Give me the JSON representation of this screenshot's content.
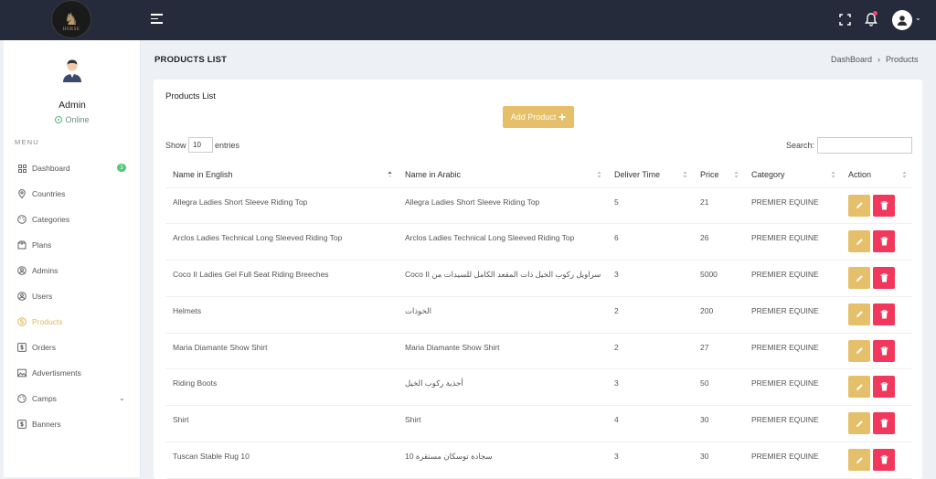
{
  "header": {
    "logo_text": "HORSE"
  },
  "sidebar": {
    "profile_name": "Admin",
    "profile_status": "Online",
    "menu_heading": "MENU",
    "items": [
      {
        "label": "Dashboard",
        "icon": "dashboard-grid-icon",
        "badge": "3"
      },
      {
        "label": "Countries",
        "icon": "map-pin-icon"
      },
      {
        "label": "Categories",
        "icon": "palette-icon"
      },
      {
        "label": "Plans",
        "icon": "box-icon"
      },
      {
        "label": "Admins",
        "icon": "user-circle-icon"
      },
      {
        "label": "Users",
        "icon": "user-circle-icon"
      },
      {
        "label": "Products",
        "icon": "coin-icon",
        "active": true
      },
      {
        "label": "Orders",
        "icon": "dollar-square-icon"
      },
      {
        "label": "Advertisments",
        "icon": "image-icon"
      },
      {
        "label": "Camps",
        "icon": "palette-icon",
        "expandable": true
      },
      {
        "label": "Banners",
        "icon": "dollar-square-icon"
      }
    ]
  },
  "page": {
    "title": "PRODUCTS LIST",
    "breadcrumb": [
      "DashBoard",
      "Products"
    ]
  },
  "card": {
    "title": "Products List",
    "add_button": "Add Product",
    "show_label": "Show",
    "entries_value": "10",
    "entries_label": "entries",
    "search_label": "Search:"
  },
  "table": {
    "columns": [
      "Name in English",
      "Name in Arabic",
      "Deliver Time",
      "Price",
      "Category",
      "Action"
    ],
    "rows": [
      {
        "en": "Allegra Ladies Short Sleeve Riding Top",
        "ar": "Allegra Ladies Short Sleeve Riding Top",
        "time": "5",
        "price": "21",
        "category": "PREMIER EQUINE"
      },
      {
        "en": "Arclos Ladies Technical Long Sleeved Riding Top",
        "ar": "Arclos Ladies Technical Long Sleeved Riding Top",
        "time": "6",
        "price": "26",
        "category": "PREMIER EQUINE"
      },
      {
        "en": "Coco II Ladies Gel Full Seat Riding Breeches",
        "ar": "سراويل ركوب الخيل ذات المقعد الكامل للسيدات من Coco II",
        "time": "3",
        "price": "5000",
        "category": "PREMIER EQUINE"
      },
      {
        "en": "Helmets",
        "ar": "الخوذات",
        "time": "2",
        "price": "200",
        "category": "PREMIER EQUINE"
      },
      {
        "en": "Maria Diamante Show Shirt",
        "ar": "Maria Diamante Show Shirt",
        "time": "2",
        "price": "27",
        "category": "PREMIER EQUINE"
      },
      {
        "en": "Riding Boots",
        "ar": "أحذية ركوب الخيل",
        "time": "3",
        "price": "50",
        "category": "PREMIER EQUINE"
      },
      {
        "en": "Shirt",
        "ar": "Shirt",
        "time": "4",
        "price": "30",
        "category": "PREMIER EQUINE"
      },
      {
        "en": "Tuscan Stable Rug 10",
        "ar": "سجادة توسكان مستقرة 10",
        "time": "3",
        "price": "30",
        "category": "PREMIER EQUINE"
      }
    ]
  },
  "colors": {
    "topbar": "#252b3b",
    "accent": "#e5bf6a",
    "danger": "#f1375c",
    "success": "#52c878"
  }
}
